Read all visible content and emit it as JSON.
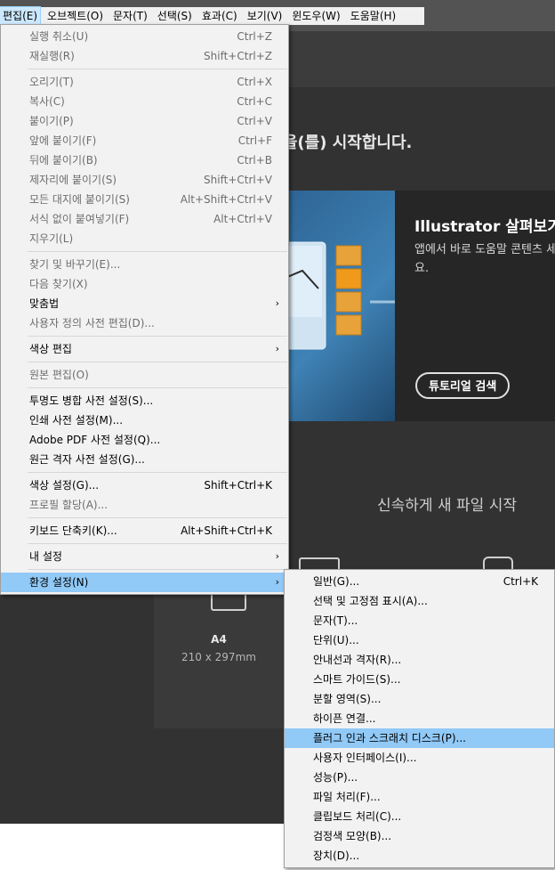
{
  "menubar": [
    {
      "label": "편집(E)",
      "active": true
    },
    {
      "label": "오브젝트(O)"
    },
    {
      "label": "문자(T)"
    },
    {
      "label": "선택(S)"
    },
    {
      "label": "효과(C)"
    },
    {
      "label": "보기(V)"
    },
    {
      "label": "윈도우(W)"
    },
    {
      "label": "도움말(H)"
    }
  ],
  "home": {
    "welcome_fragment": "r을(를) 시작합니다.",
    "banner": {
      "title": "Illustrator 살펴보기",
      "description": "앱에서 바로 도움말 콘텐츠 세요.",
      "button": "튜토리얼 검색"
    },
    "quick_start": "신속하게 새 파일 시작",
    "preset": {
      "name": "A4",
      "size": "210 x 297mm"
    }
  },
  "edit_menu": [
    {
      "label": "실행 취소(U)",
      "shortcut": "Ctrl+Z",
      "disabled": true
    },
    {
      "label": "재실행(R)",
      "shortcut": "Shift+Ctrl+Z",
      "disabled": true
    },
    {
      "sep": true
    },
    {
      "label": "오리기(T)",
      "shortcut": "Ctrl+X",
      "disabled": true
    },
    {
      "label": "복사(C)",
      "shortcut": "Ctrl+C",
      "disabled": true
    },
    {
      "label": "붙이기(P)",
      "shortcut": "Ctrl+V",
      "disabled": true
    },
    {
      "label": "앞에 붙이기(F)",
      "shortcut": "Ctrl+F",
      "disabled": true
    },
    {
      "label": "뒤에 붙이기(B)",
      "shortcut": "Ctrl+B",
      "disabled": true
    },
    {
      "label": "제자리에 붙이기(S)",
      "shortcut": "Shift+Ctrl+V",
      "disabled": true
    },
    {
      "label": "모든 대지에 붙이기(S)",
      "shortcut": "Alt+Shift+Ctrl+V",
      "disabled": true
    },
    {
      "label": "서식 없이 붙여넣기(F)",
      "shortcut": "Alt+Ctrl+V",
      "disabled": true
    },
    {
      "label": "지우기(L)",
      "disabled": true
    },
    {
      "sep": true
    },
    {
      "label": "찾기 및 바꾸기(E)...",
      "disabled": true
    },
    {
      "label": "다음 찾기(X)",
      "disabled": true
    },
    {
      "label": "맞춤법",
      "submenu": true
    },
    {
      "label": "사용자 정의 사전 편집(D)...",
      "disabled": true
    },
    {
      "sep": true
    },
    {
      "label": "색상 편집",
      "submenu": true
    },
    {
      "sep": true
    },
    {
      "label": "원본 편집(O)",
      "disabled": true
    },
    {
      "sep": true
    },
    {
      "label": "투명도 병합 사전 설정(S)..."
    },
    {
      "label": "인쇄 사전 설정(M)..."
    },
    {
      "label": "Adobe PDF 사전 설정(Q)..."
    },
    {
      "label": "원근 격자 사전 설정(G)..."
    },
    {
      "sep": true
    },
    {
      "label": "색상 설정(G)...",
      "shortcut": "Shift+Ctrl+K"
    },
    {
      "label": "프로필 할당(A)...",
      "disabled": true
    },
    {
      "sep": true
    },
    {
      "label": "키보드 단축키(K)...",
      "shortcut": "Alt+Shift+Ctrl+K"
    },
    {
      "sep": true
    },
    {
      "label": "내 설정",
      "submenu": true
    },
    {
      "sep": true
    },
    {
      "label": "환경 설정(N)",
      "submenu": true,
      "highlighted": true
    }
  ],
  "preferences_menu": [
    {
      "label": "일반(G)...",
      "shortcut": "Ctrl+K"
    },
    {
      "label": "선택 및 고정점 표시(A)..."
    },
    {
      "label": "문자(T)..."
    },
    {
      "label": "단위(U)..."
    },
    {
      "label": "안내선과 격자(R)..."
    },
    {
      "label": "스마트 가이드(S)..."
    },
    {
      "label": "분할 영역(S)..."
    },
    {
      "label": "하이픈 연결..."
    },
    {
      "label": "플러그 인과 스크래치 디스크(P)...",
      "highlighted": true
    },
    {
      "label": "사용자 인터페이스(I)..."
    },
    {
      "label": "성능(P)..."
    },
    {
      "label": "파일 처리(F)..."
    },
    {
      "label": "클립보드 처리(C)..."
    },
    {
      "label": "검정색 모양(B)..."
    },
    {
      "label": "장치(D)..."
    }
  ],
  "colors": {
    "highlight": "#91c9f7",
    "menu_bg": "#f2f2f2",
    "app_bg": "#323232"
  }
}
